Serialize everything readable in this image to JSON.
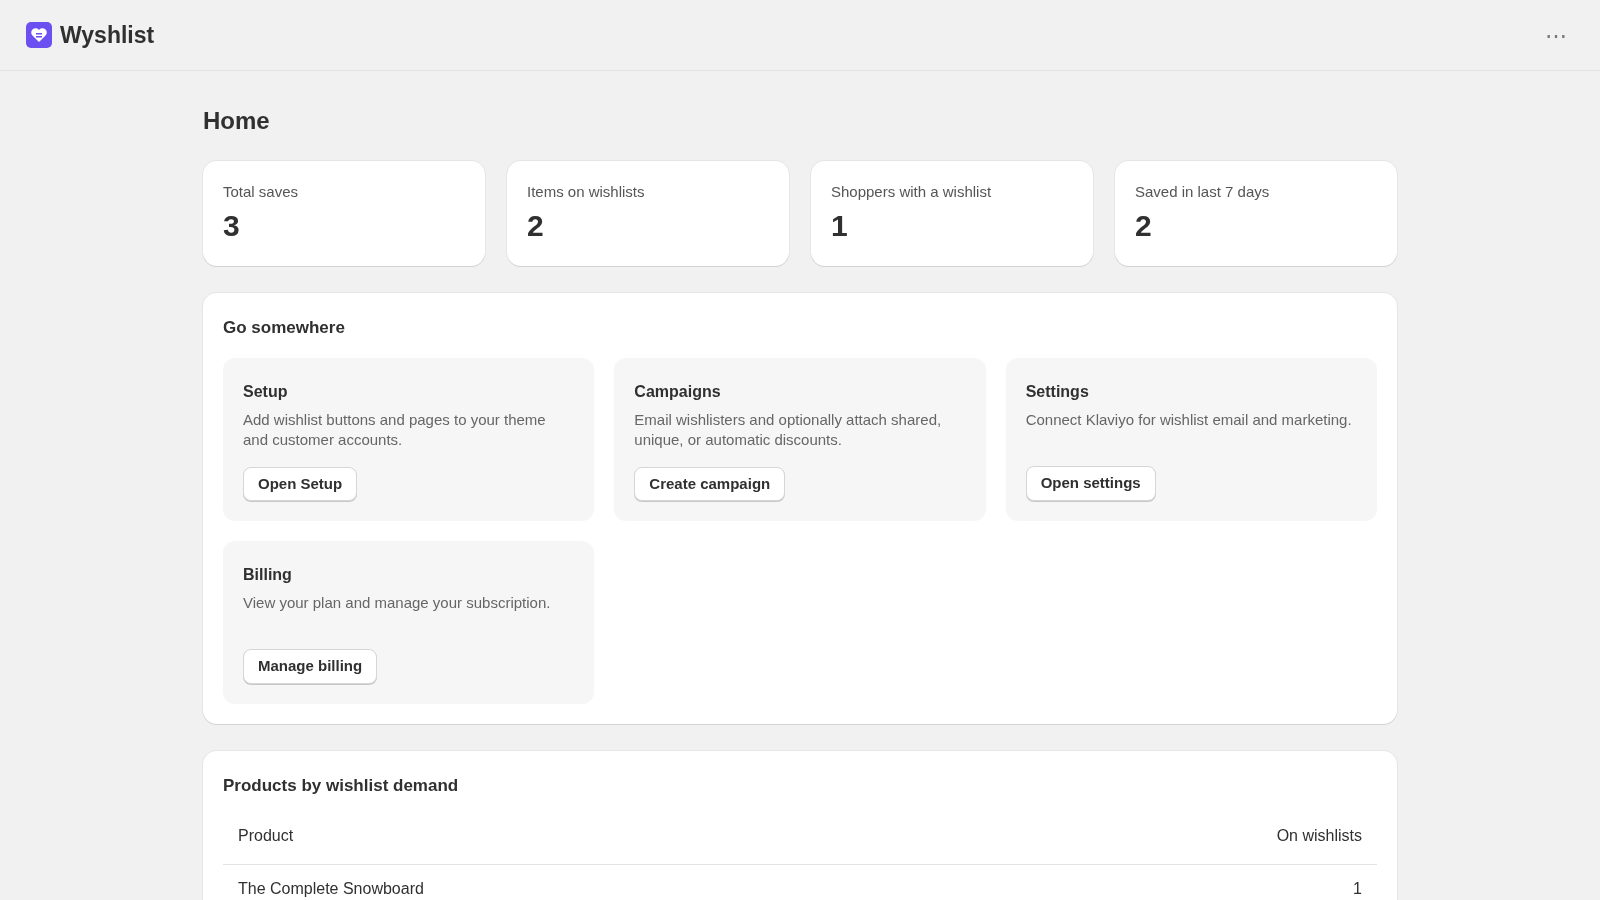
{
  "app": {
    "name": "Wyshlist",
    "menu": "⋯"
  },
  "page": {
    "title": "Home"
  },
  "stats": [
    {
      "label": "Total saves",
      "value": "3"
    },
    {
      "label": "Items on wishlists",
      "value": "2"
    },
    {
      "label": "Shoppers with a wishlist",
      "value": "1"
    },
    {
      "label": "Saved in last 7 days",
      "value": "2"
    }
  ],
  "go_somewhere": {
    "title": "Go somewhere",
    "tiles": [
      {
        "title": "Setup",
        "description": "Add wishlist buttons and pages to your theme and customer accounts.",
        "button": "Open Setup"
      },
      {
        "title": "Campaigns",
        "description": "Email wishlisters and optionally attach shared, unique, or automatic discounts.",
        "button": "Create campaign"
      },
      {
        "title": "Settings",
        "description": "Connect Klaviyo for wishlist email and marketing.",
        "button": "Open settings"
      },
      {
        "title": "Billing",
        "description": "View your plan and manage your subscription.",
        "button": "Manage billing"
      }
    ]
  },
  "products": {
    "title": "Products by wishlist demand",
    "columns": [
      "Product",
      "On wishlists"
    ],
    "rows": [
      {
        "product": "The Complete Snowboard",
        "on_wishlists": "1"
      }
    ]
  }
}
